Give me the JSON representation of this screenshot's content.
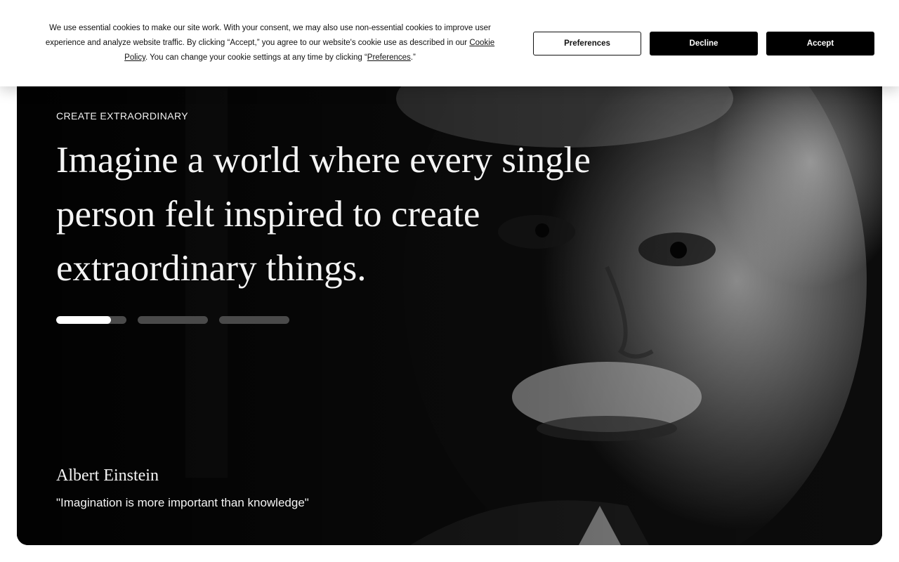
{
  "cookie_banner": {
    "text_part1": "We use essential cookies to make our site work. With your consent, we may also use non-essential cookies to improve user experience and analyze website traffic. By clicking “Accept,” you agree to our website's cookie use as described in our ",
    "cookie_policy_link": "Cookie Policy",
    "text_part2": ". You can change your cookie settings at any time by clicking “",
    "preferences_link": "Preferences",
    "text_part3": ".”",
    "preferences_button": "Preferences",
    "decline_button": "Decline",
    "accept_button": "Accept"
  },
  "hero": {
    "eyebrow": "CREATE EXTRAORDINARY",
    "headline": "Imagine a world where every single person felt inspired to create extraordinary things.",
    "slides": [
      {
        "progress": 0.78
      },
      {
        "progress": 0
      },
      {
        "progress": 0
      }
    ],
    "quote_author": "Albert Einstein",
    "quote_text": "\"Imagination is more important than knowledge\""
  }
}
